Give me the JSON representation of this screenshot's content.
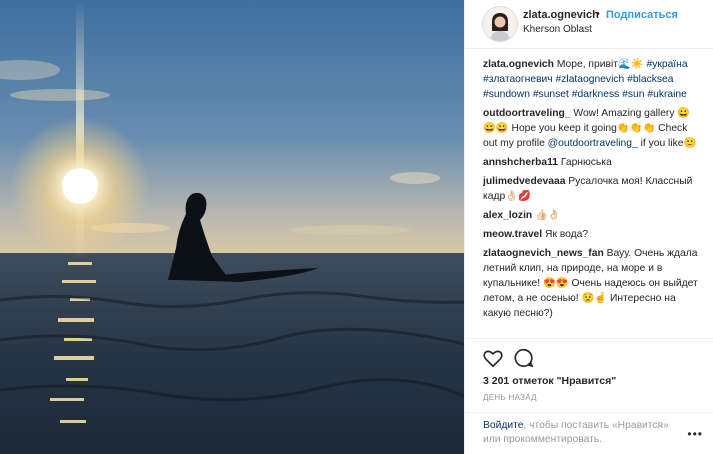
{
  "header": {
    "username": "zlata.ognevich",
    "separator": "•",
    "follow_label": "Подписаться",
    "location": "Kherson Oblast"
  },
  "caption": {
    "user": "zlata.ognevich",
    "text": "Море, привіт🌊☀️",
    "tags": [
      "#україна",
      "#златаогневич",
      "#zlataognevich",
      "#blacksea",
      "#sundown",
      "#sunset",
      "#darkness",
      "#sun",
      "#ukraine"
    ]
  },
  "comments": [
    {
      "user": "outdoortraveling_",
      "text_a": "Wow! Amazing  gallery 😀😀😀 Hope you keep it going👏👏👏",
      "text_b": "Check out my profile ",
      "mention": "@outdoortraveling_",
      "text_c": " if you like🙂"
    },
    {
      "user": "annshcherba11",
      "text": "Гарнюська"
    },
    {
      "user": "julimedvedevaaa",
      "text": "Русалочка моя! Классный кадр👌🏻💋"
    },
    {
      "user": "alex_lozin",
      "text": "👍🏻👌🏻"
    },
    {
      "user": "meow.travel",
      "text": "Як вода?"
    },
    {
      "user": "zlataognevich_news_fan",
      "text": "Вауу. Очень ждала летний клип, на природе, на море и в купальнике! 😍😍 Очень надеюсь он выйдет летом, а не осенью! 😟☝️ Интересно на какую песню?)"
    }
  ],
  "actions": {
    "likes": "3 201 отметок \"Нравится\"",
    "time": "ДЕНЬ НАЗАД"
  },
  "login": {
    "login_link": "Войдите",
    "text1": ", чтобы поставить «Нравится»",
    "text2": "или прокомментировать.",
    "more": "•••"
  },
  "icons": {
    "like": "heart-icon",
    "comment": "comment-icon",
    "more": "more-options-icon"
  }
}
